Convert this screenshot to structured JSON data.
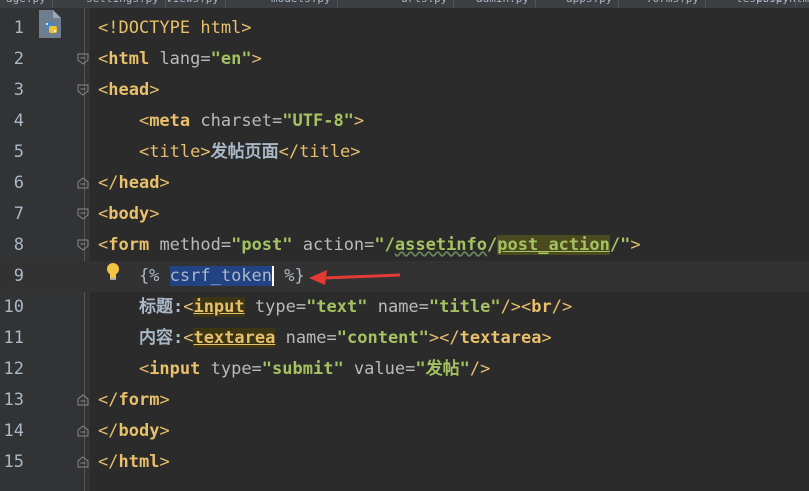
{
  "tabs": [
    "age.py",
    "settings.py",
    "views.py",
    "models.py",
    "urls.py",
    "admin.py",
    "apps.py",
    "forms.py",
    "tests.py",
    "post.html"
  ],
  "lines": [
    {
      "n": "1",
      "parts": [
        [
          "<!DOCTYPE html>",
          "tag"
        ]
      ]
    },
    {
      "n": "2",
      "parts": [
        [
          "<",
          "tag"
        ],
        [
          "html",
          "tag b"
        ],
        [
          " lang=",
          "attr"
        ],
        [
          "\"en\"",
          "val b"
        ],
        [
          ">",
          "tag"
        ]
      ]
    },
    {
      "n": "3",
      "parts": [
        [
          "<",
          "tag"
        ],
        [
          "head",
          "tag b"
        ],
        [
          ">",
          "tag"
        ]
      ]
    },
    {
      "n": "4",
      "parts": [
        [
          "    <",
          "tag"
        ],
        [
          "meta",
          "tag b"
        ],
        [
          " charset=",
          "attr"
        ],
        [
          "\"UTF-8\"",
          "val b"
        ],
        [
          ">",
          "tag"
        ]
      ]
    },
    {
      "n": "5",
      "parts": [
        [
          "    <",
          "tag"
        ],
        [
          "title",
          "tag"
        ],
        [
          ">",
          "tag"
        ],
        [
          "发帖页面",
          "text b"
        ],
        [
          "</",
          "tag"
        ],
        [
          "title",
          "tag"
        ],
        [
          ">",
          "tag"
        ]
      ]
    },
    {
      "n": "6",
      "parts": [
        [
          "</",
          "tag"
        ],
        [
          "head",
          "tag b"
        ],
        [
          ">",
          "tag"
        ]
      ]
    },
    {
      "n": "7",
      "parts": [
        [
          "<",
          "tag"
        ],
        [
          "body",
          "tag b"
        ],
        [
          ">",
          "tag"
        ]
      ]
    },
    {
      "n": "8",
      "parts": [
        [
          "<",
          "tag"
        ],
        [
          "form",
          "tag b"
        ],
        [
          " method=",
          "attr"
        ],
        [
          "\"post\"",
          "val b"
        ],
        [
          " action=",
          "attr"
        ],
        [
          "\"/",
          "val b"
        ],
        [
          "assetinfo",
          "val b wavy"
        ],
        [
          "/",
          "val b"
        ],
        [
          "post_action",
          "val b u hl2"
        ],
        [
          "/\"",
          "val b"
        ],
        [
          ">",
          "tag"
        ]
      ]
    },
    {
      "n": "9",
      "parts": [
        [
          "    {% ",
          "tpl"
        ],
        [
          "csrf_token",
          "tpl sel"
        ],
        [
          "CARET",
          "caret"
        ],
        [
          " %}",
          "tpl"
        ]
      ]
    },
    {
      "n": "10",
      "parts": [
        [
          "    ",
          "text"
        ],
        [
          "标题:",
          "text b"
        ],
        [
          "<",
          "tag"
        ],
        [
          "input",
          "tag b u hl"
        ],
        [
          " type=",
          "attr"
        ],
        [
          "\"text\"",
          "val b"
        ],
        [
          " name=",
          "attr"
        ],
        [
          "\"title\"",
          "val b"
        ],
        [
          "/><",
          "tag"
        ],
        [
          "br",
          "tag b"
        ],
        [
          "/>",
          "tag"
        ]
      ]
    },
    {
      "n": "11",
      "parts": [
        [
          "    ",
          "text"
        ],
        [
          "内容:",
          "text b"
        ],
        [
          "<",
          "tag"
        ],
        [
          "textarea",
          "tag b u hl"
        ],
        [
          " name=",
          "attr"
        ],
        [
          "\"content\"",
          "val b"
        ],
        [
          "></",
          "tag"
        ],
        [
          "textarea",
          "tag b"
        ],
        [
          ">",
          "tag"
        ]
      ]
    },
    {
      "n": "12",
      "parts": [
        [
          "    <",
          "tag"
        ],
        [
          "input",
          "tag b"
        ],
        [
          " type=",
          "attr"
        ],
        [
          "\"submit\"",
          "val b"
        ],
        [
          " value=",
          "attr"
        ],
        [
          "\"发帖\"",
          "val b"
        ],
        [
          "/>",
          "tag"
        ]
      ]
    },
    {
      "n": "13",
      "parts": [
        [
          "</",
          "tag"
        ],
        [
          "form",
          "tag b"
        ],
        [
          ">",
          "tag"
        ]
      ]
    },
    {
      "n": "14",
      "parts": [
        [
          "</",
          "tag"
        ],
        [
          "body",
          "tag b"
        ],
        [
          ">",
          "tag"
        ]
      ]
    },
    {
      "n": "15",
      "parts": [
        [
          "</",
          "tag"
        ],
        [
          "html",
          "tag b"
        ],
        [
          ">",
          "tag"
        ]
      ]
    }
  ],
  "colors": {
    "background": "#2b2b2b",
    "tag": "#e8bf6a",
    "attribute": "#bababa",
    "value": "#a5c261",
    "arrow": "#e53935"
  },
  "icons": [
    "python-file-icon",
    "lightbulb-icon",
    "fold-marker-icon",
    "red-arrow-annotation"
  ]
}
